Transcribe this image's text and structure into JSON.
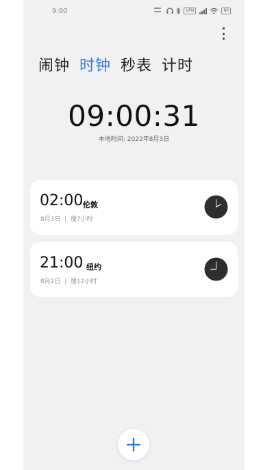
{
  "status_bar": {
    "time": "9:00",
    "vpn": "VPN",
    "battery": "80"
  },
  "tabs": [
    {
      "label": "闹钟",
      "active": false
    },
    {
      "label": "时钟",
      "active": true
    },
    {
      "label": "秒表",
      "active": false
    },
    {
      "label": "计时",
      "active": false
    }
  ],
  "clock": {
    "time": "09:00:31",
    "local_date": "本地时间: 2022年8月3日"
  },
  "cities": [
    {
      "time": "02:00",
      "name": "伦敦",
      "date": "8月3日",
      "diff": "慢7小时",
      "hour": 2,
      "minute": 0
    },
    {
      "time": "21:00",
      "name": "纽约",
      "date": "8月2日",
      "diff": "慢12小时",
      "hour": 21,
      "minute": 0
    }
  ],
  "colors": {
    "accent": "#2b7de0",
    "background": "#f1f1f3",
    "card": "#ffffff"
  },
  "icons": {
    "more": "more-vert-icon",
    "add": "plus-icon",
    "clock": "analog-clock-icon"
  }
}
